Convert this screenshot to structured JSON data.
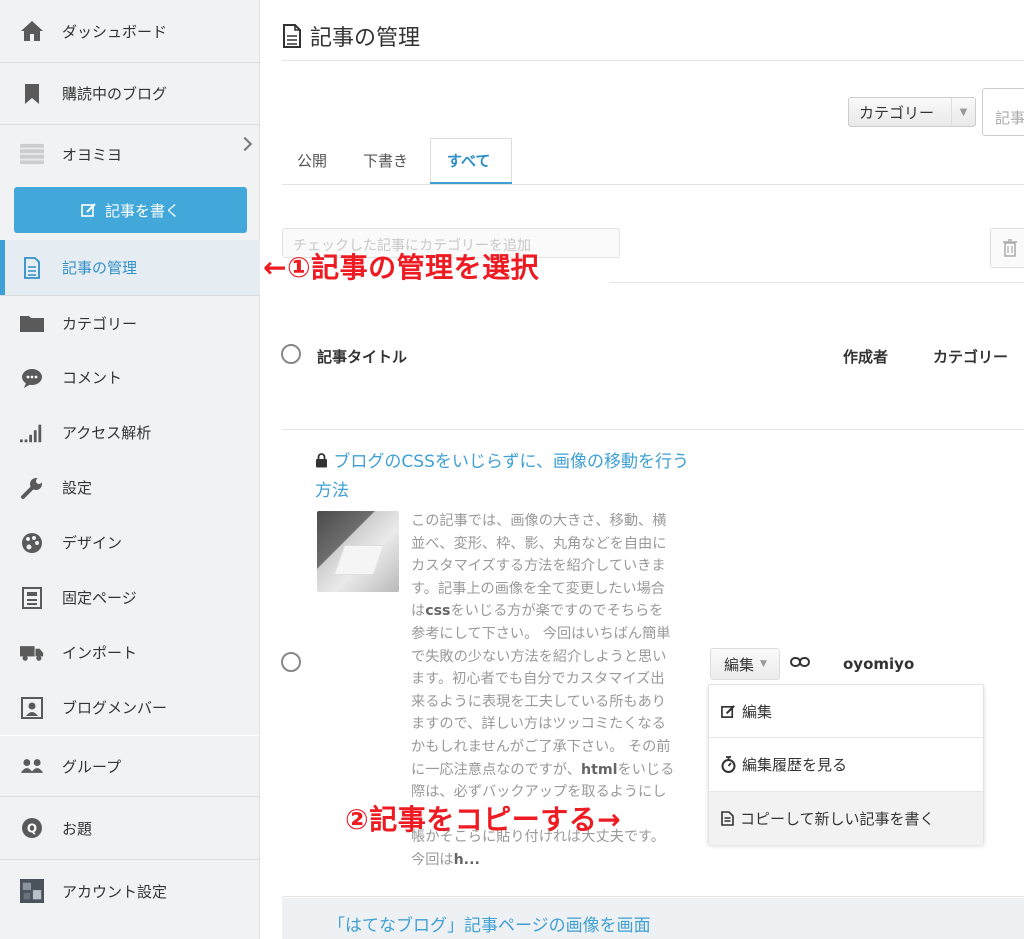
{
  "sidebar": {
    "items": [
      {
        "label": "ダッシュボード",
        "icon": "home-icon"
      },
      {
        "label": "購読中のブログ",
        "icon": "bookmark-icon"
      },
      {
        "label": "オヨミヨ",
        "icon": "blog-avatar-icon"
      },
      {
        "label": "記事を書く",
        "icon": "edit-icon"
      },
      {
        "label": "記事の管理",
        "icon": "document-icon"
      },
      {
        "label": "カテゴリー",
        "icon": "folder-icon"
      },
      {
        "label": "コメント",
        "icon": "comment-icon"
      },
      {
        "label": "アクセス解析",
        "icon": "bar-chart-icon"
      },
      {
        "label": "設定",
        "icon": "wrench-icon"
      },
      {
        "label": "デザイン",
        "icon": "palette-icon"
      },
      {
        "label": "固定ページ",
        "icon": "fixed-page-icon"
      },
      {
        "label": "インポート",
        "icon": "truck-icon"
      },
      {
        "label": "ブログメンバー",
        "icon": "member-icon"
      },
      {
        "label": "グループ",
        "icon": "group-icon"
      },
      {
        "label": "お題",
        "icon": "topic-icon"
      },
      {
        "label": "アカウント設定",
        "icon": "account-avatar-icon"
      }
    ]
  },
  "main": {
    "page_title": "記事の管理",
    "category_select": "カテゴリー",
    "search_placeholder": "記事",
    "tabs": [
      {
        "label": "公開"
      },
      {
        "label": "下書き"
      },
      {
        "label": "すべて",
        "active": true
      }
    ],
    "bulk_action": "チェックした記事にカテゴリーを追加",
    "table_headers": {
      "title": "記事タイトル",
      "author": "作成者",
      "category": "カテゴリー"
    },
    "article": {
      "title": "ブログのCSSをいじらずに、画像の移動を行う方法",
      "excerpt_lines": [
        "この記事では、画像の大きさ、移動、横",
        "並べ、変形、枠、影、丸角などを自由に",
        "カスタマイズする方法を紹介していきま",
        "す。記事上の画像を全て変更したい場合",
        "はcssをいじる方が楽ですのでそちらを",
        "参考にして下さい。 今回はいちばん簡単",
        "で失敗の少ない方法を紹介しようと思い",
        "ます。初心者でも自分でカスタマイズ出",
        "来るように表現を工夫している所もあり",
        "ますので、詳しい方はツッコミたくなる",
        "かもしれませんがご了承下さい。 その前",
        "に一応注意点なのですが、htmlをいじる",
        "際は、必ずバックアップを取るようにし",
        "",
        "帳かそこらに貼り付ければ大丈夫です。",
        "今回はh..."
      ],
      "edit_button": "編集",
      "author": "oyomiyo"
    },
    "edit_menu": [
      {
        "label": "編集",
        "icon": "edit-icon"
      },
      {
        "label": "編集履歴を見る",
        "icon": "stopwatch-icon"
      },
      {
        "label": "コピーして新しい記事を書く",
        "icon": "document-icon"
      }
    ],
    "next_article_title": "「はてなブログ」記事ページの画像を画面"
  },
  "annotations": {
    "step1": "←①記事の管理を選択",
    "step2": "②記事をコピーする→"
  },
  "colors": {
    "accent": "#3fa0d5",
    "annotation": "#ee1b23",
    "sidebar_bg": "#f1f2f3"
  }
}
